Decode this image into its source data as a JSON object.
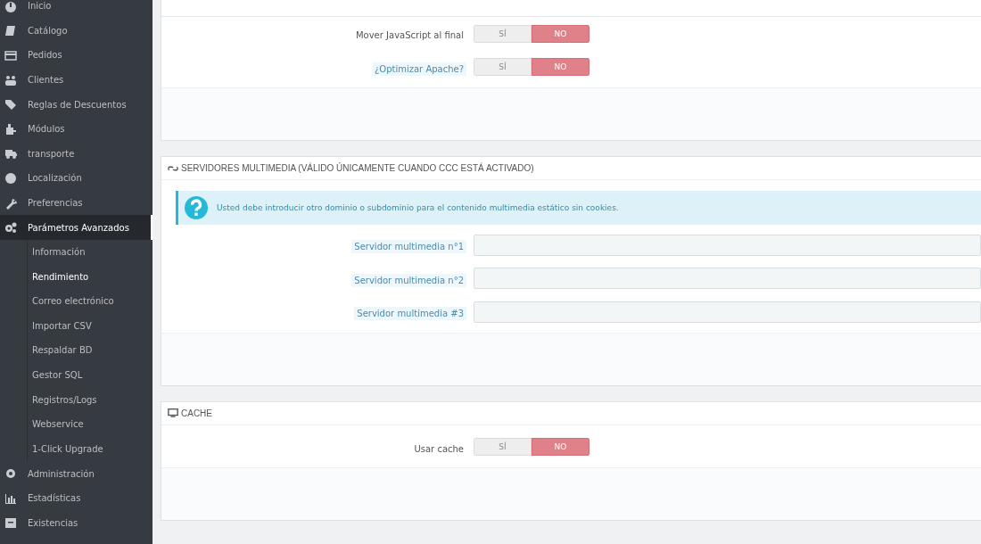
{
  "sidebar": {
    "items": [
      {
        "label": "Inicio",
        "selected": false
      },
      {
        "label": "Catálogo",
        "selected": false
      },
      {
        "label": "Pedidos",
        "selected": false
      },
      {
        "label": "Clientes",
        "selected": false
      },
      {
        "label": "Reglas de Descuentos",
        "selected": false
      },
      {
        "label": "Módulos",
        "selected": false
      },
      {
        "label": "transporte",
        "selected": false
      },
      {
        "label": "Localización",
        "selected": false
      },
      {
        "label": "Preferencias",
        "selected": false
      },
      {
        "label": "Parámetros Avanzados",
        "selected": true,
        "expanded": true,
        "children": [
          {
            "label": "Información",
            "selected": false
          },
          {
            "label": "Rendimiento",
            "selected": true
          },
          {
            "label": "Correo electrónico",
            "selected": false
          },
          {
            "label": "Importar CSV",
            "selected": false
          },
          {
            "label": "Respaldar BD",
            "selected": false
          },
          {
            "label": "Gestor SQL",
            "selected": false
          },
          {
            "label": "Registros/Logs",
            "selected": false
          },
          {
            "label": "Webservice",
            "selected": false
          },
          {
            "label": "1-Click Upgrade",
            "selected": false
          }
        ]
      },
      {
        "label": "Administración",
        "selected": false
      },
      {
        "label": "Estadísticas",
        "selected": false
      },
      {
        "label": "Existencias",
        "selected": false
      }
    ]
  },
  "panels": [
    {
      "fields": [
        {
          "kind": "toggle",
          "label": "Mover JavaScript al final",
          "hint": false,
          "yes": "SÍ",
          "no": "NO",
          "on": false
        },
        {
          "kind": "toggle",
          "label": "¿Optimizar Apache?",
          "hint": true,
          "yes": "SÍ",
          "no": "NO",
          "on": false
        }
      ]
    },
    {
      "heading": "SERVIDORES MULTIMEDIA (VÁLIDO ÚNICAMENTE CUANDO CCC ESTÁ ACTIVADO)",
      "alert": "Usted debe introducir otro dominio o subdominio para el contenido multimedia estático sin cookies.",
      "fields": [
        {
          "kind": "text",
          "label": "Servidor multimedia n°1",
          "hint": true
        },
        {
          "kind": "text",
          "label": "Servidor multimedia n°2",
          "hint": true
        },
        {
          "kind": "text",
          "label": "Servidor multimedia #3",
          "hint": true
        }
      ]
    },
    {
      "heading": "CACHE",
      "fields": [
        {
          "kind": "toggle",
          "label": "Usar cache",
          "hint": false,
          "yes": "SÍ",
          "no": "NO",
          "on": false
        }
      ]
    }
  ]
}
